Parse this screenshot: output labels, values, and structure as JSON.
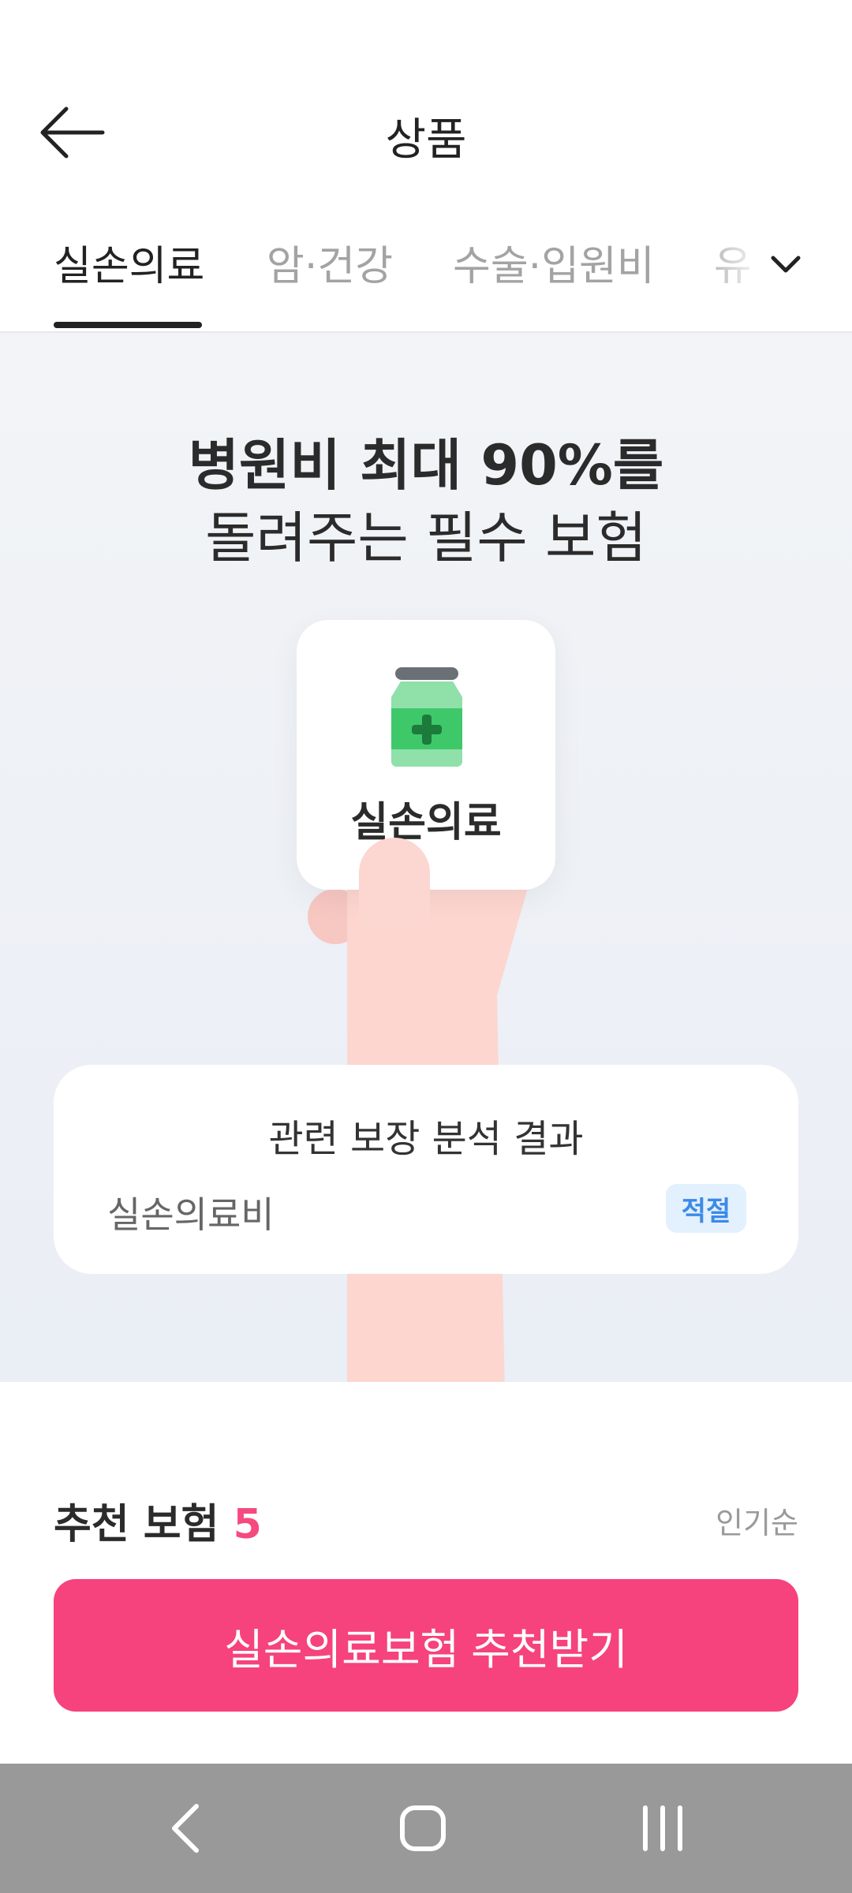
{
  "header": {
    "title": "상품"
  },
  "tabs": [
    {
      "label": "실손의료"
    },
    {
      "label": "암·건강"
    },
    {
      "label": "수술·입원비"
    },
    {
      "label": "유"
    }
  ],
  "hero": {
    "line1": "병원비 최대 90%를",
    "line2": "돌려주는 필수 보험",
    "card_label": "실손의료"
  },
  "analysis": {
    "title": "관련 보장 분석 결과",
    "item_label": "실손의료비",
    "item_status": "적절"
  },
  "recommend": {
    "title": "추천 보험",
    "count": "5",
    "sort_label": "인기순",
    "cta_label": "실손의료보험 추천받기"
  },
  "colors": {
    "accent": "#f6427d",
    "badge_text": "#3b8ae8",
    "badge_bg": "#e3f0fd",
    "icon_green": "#3ec86a"
  }
}
